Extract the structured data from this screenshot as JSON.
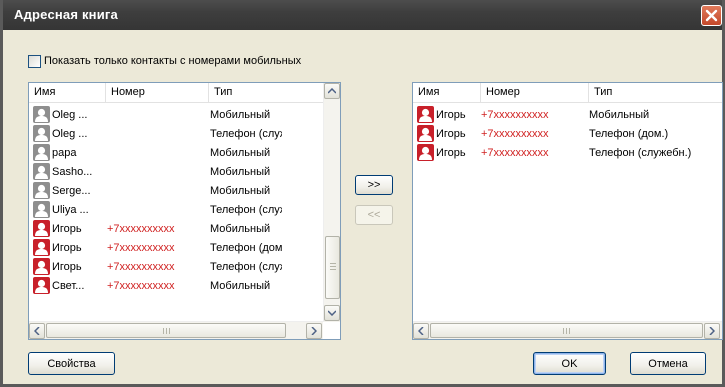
{
  "window": {
    "title": "Адресная книга"
  },
  "filter": {
    "label": "Показать только контакты с номерами мобильных",
    "checked": false
  },
  "left_list": {
    "columns": [
      "Имя",
      "Номер",
      "Тип"
    ],
    "rows": [
      {
        "name": "Oleg ...",
        "number": "",
        "type": "Мобильный",
        "avatar": "gray-contact-icon"
      },
      {
        "name": "Oleg ...",
        "number": "",
        "type": "Телефон (служебн.)",
        "avatar": "gray-contact-icon"
      },
      {
        "name": "papa",
        "number": "",
        "type": "Мобильный",
        "avatar": "gray-contact-icon"
      },
      {
        "name": "Sasho...",
        "number": "",
        "type": "Мобильный",
        "avatar": "gray-contact-icon"
      },
      {
        "name": "Serge...",
        "number": "",
        "type": "Мобильный",
        "avatar": "gray-contact-icon"
      },
      {
        "name": "Uliya ...",
        "number": "",
        "type": "Телефон (служебн.)",
        "avatar": "gray-contact-icon"
      },
      {
        "name": "Игорь",
        "number": "+7xxxxxxxxxx",
        "type": "Мобильный",
        "avatar": "red-contact-icon"
      },
      {
        "name": "Игорь",
        "number": "+7xxxxxxxxxx",
        "type": "Телефон (дом.)",
        "avatar": "red-contact-icon"
      },
      {
        "name": "Игорь",
        "number": "+7xxxxxxxxxx",
        "type": "Телефон (служебн.)",
        "avatar": "red-contact-icon"
      },
      {
        "name": "Свет...",
        "number": "+7xxxxxxxxxx",
        "type": "Мобильный",
        "avatar": "red-contact-icon"
      }
    ],
    "vscroll_position": 0.85
  },
  "right_list": {
    "columns": [
      "Имя",
      "Номер",
      "Тип"
    ],
    "rows": [
      {
        "name": "Игорь",
        "number": "+7xxxxxxxxxx",
        "type": "Мобильный",
        "avatar": "red-contact-icon"
      },
      {
        "name": "Игорь",
        "number": "+7xxxxxxxxxx",
        "type": "Телефон (дом.)",
        "avatar": "red-contact-icon"
      },
      {
        "name": "Игорь",
        "number": "+7xxxxxxxxxx",
        "type": "Телефон (служебн.)",
        "avatar": "red-contact-icon"
      }
    ]
  },
  "buttons": {
    "add": ">>",
    "remove": "<<",
    "properties": "Свойства",
    "ok": "OK",
    "cancel": "Отмена"
  },
  "colors": {
    "phone_text": "#d02020",
    "red_avatar": "#c8202a",
    "gray_avatar": "#8e8e8e"
  }
}
